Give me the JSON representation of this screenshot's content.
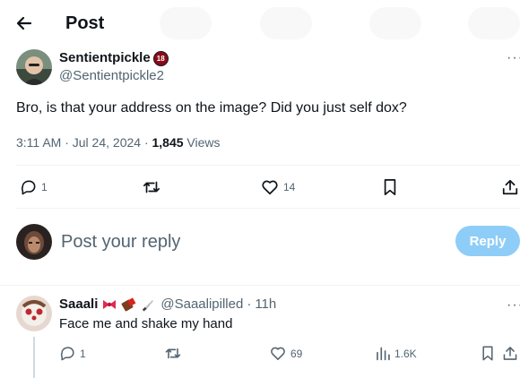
{
  "header": {
    "title": "Post",
    "back_icon": "arrow-left-icon"
  },
  "tweet": {
    "author_name": "Sentientpickle",
    "badge": "18",
    "handle": "@Sentientpickle2",
    "text": "Bro, is that your address on the image? Did you just self dox?",
    "time": "3:11 AM · Jul 24, 2024 · ",
    "views_count": "1,845",
    "views_label": " Views",
    "more": "···",
    "actions": {
      "replies": "1",
      "reposts": "",
      "likes": "14"
    }
  },
  "reply_box": {
    "placeholder": "Post your reply",
    "button_label": "Reply"
  },
  "reply": {
    "author_name": "Saaali",
    "emojis": [
      "bow-emoji",
      "chocolate-emoji",
      "knife-emoji"
    ],
    "handle": "@Saaalipilled",
    "separator": " · ",
    "time": "11h",
    "more": "···",
    "text": "Face me and shake my hand",
    "actions": {
      "replies": "1",
      "reposts": "",
      "likes": "69",
      "views": "1.6K"
    }
  },
  "colors": {
    "accent": "#1d9bf0",
    "reply_button": "#8ecdf8",
    "badge": "#8b0a1a",
    "muted": "#536471"
  }
}
